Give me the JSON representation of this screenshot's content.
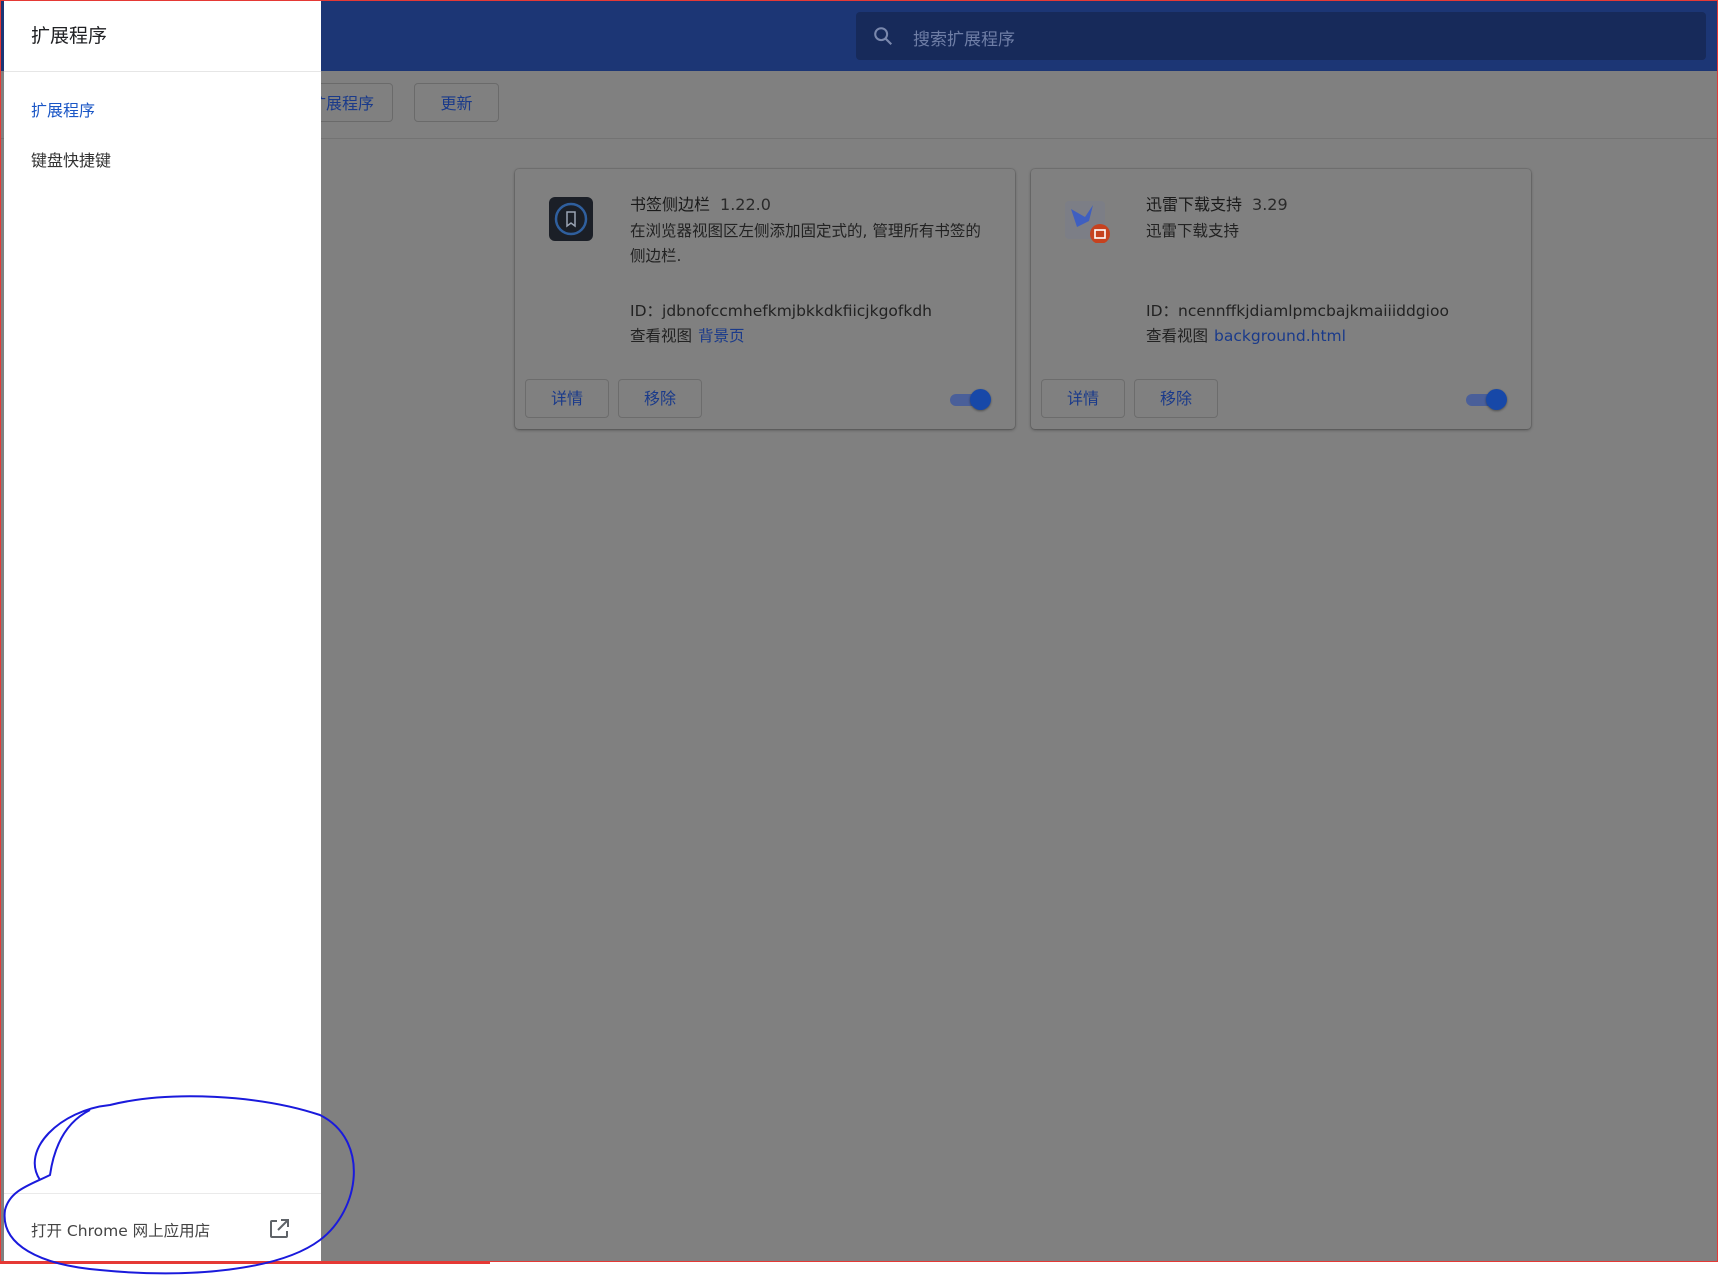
{
  "header": {
    "search_placeholder": "搜索扩展程序"
  },
  "toolbar": {
    "load_label": "扩展程序",
    "update_label": "更新"
  },
  "sidebar": {
    "title": "扩展程序",
    "items": [
      {
        "label": "扩展程序",
        "active": true
      },
      {
        "label": "键盘快捷键",
        "active": false
      }
    ],
    "store_link": "打开 Chrome 网上应用店"
  },
  "extensions": [
    {
      "name": "书签侧边栏",
      "version": "1.22.0",
      "description": "在浏览器视图区左侧添加固定式的, 管理所有书签的侧边栏.",
      "id_text": "ID：jdbnofccmhefkmjbkkdkfiicjkgofkdh",
      "views_label": "查看视图",
      "view_link": "背景页",
      "details_label": "详情",
      "remove_label": "移除",
      "enabled": true,
      "icon": "bookmark-sidebar-icon"
    },
    {
      "name": "迅雷下载支持",
      "version": "3.29",
      "description": "迅雷下载支持",
      "id_text": "ID：ncennffkjdiamlpmcbajkmaiiiddgioo",
      "views_label": "查看视图",
      "view_link": "background.html",
      "details_label": "详情",
      "remove_label": "移除",
      "enabled": true,
      "icon": "thunder-bird-icon"
    }
  ],
  "colors": {
    "accent": "#1a56c6",
    "header": "#1c3675",
    "overlay": "#808080",
    "annotation": "#1a1adc",
    "frame_border": "#e53935"
  }
}
